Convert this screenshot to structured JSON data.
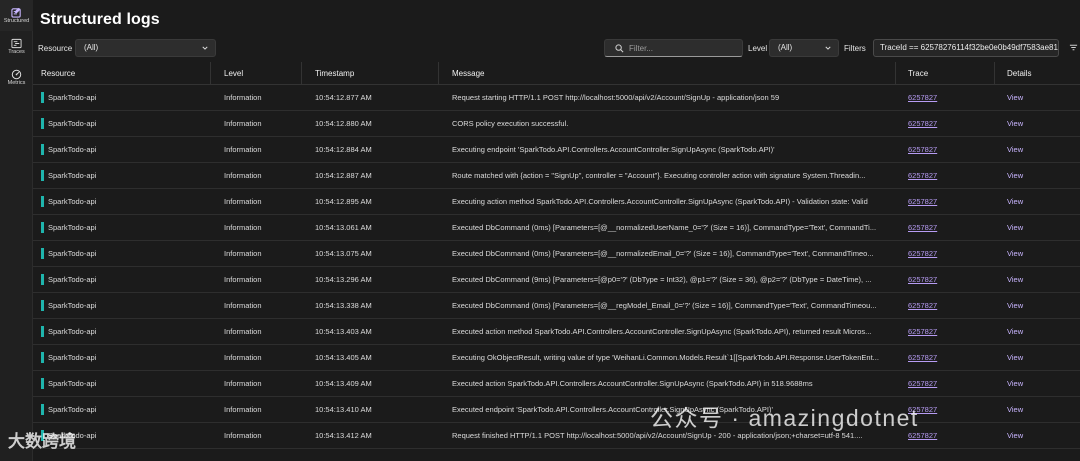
{
  "rail": {
    "items": [
      {
        "label": "Structured",
        "active": true
      },
      {
        "label": "Traces",
        "active": false
      },
      {
        "label": "Metrics",
        "active": false
      }
    ]
  },
  "header": {
    "title": "Structured logs"
  },
  "toolbar": {
    "resource_label": "Resource",
    "resource_value": "(All)",
    "search_placeholder": "Filter...",
    "level_label": "Level",
    "level_value": "(All)",
    "filters_label": "Filters",
    "filter_chip": "TraceId == 62578276114f32be0e0b49df7583ae81"
  },
  "table": {
    "columns": [
      "Resource",
      "Level",
      "Timestamp",
      "Message",
      "Trace",
      "Details"
    ],
    "rows": [
      {
        "resource": "SparkTodo-api",
        "level": "Information",
        "timestamp": "10:54:12.877 AM",
        "message": "Request starting HTTP/1.1 POST http://localhost:5000/api/v2/Account/SignUp - application/json 59",
        "trace": "6257827",
        "details": "View"
      },
      {
        "resource": "SparkTodo-api",
        "level": "Information",
        "timestamp": "10:54:12.880 AM",
        "message": "CORS policy execution successful.",
        "trace": "6257827",
        "details": "View"
      },
      {
        "resource": "SparkTodo-api",
        "level": "Information",
        "timestamp": "10:54:12.884 AM",
        "message": "Executing endpoint 'SparkTodo.API.Controllers.AccountController.SignUpAsync (SparkTodo.API)'",
        "trace": "6257827",
        "details": "View"
      },
      {
        "resource": "SparkTodo-api",
        "level": "Information",
        "timestamp": "10:54:12.887 AM",
        "message": "Route matched with {action = \"SignUp\", controller = \"Account\"}. Executing controller action with signature System.Threadin...",
        "trace": "6257827",
        "details": "View"
      },
      {
        "resource": "SparkTodo-api",
        "level": "Information",
        "timestamp": "10:54:12.895 AM",
        "message": "Executing action method SparkTodo.API.Controllers.AccountController.SignUpAsync (SparkTodo.API) - Validation state: Valid",
        "trace": "6257827",
        "details": "View"
      },
      {
        "resource": "SparkTodo-api",
        "level": "Information",
        "timestamp": "10:54:13.061 AM",
        "message": "Executed DbCommand (0ms) [Parameters=[@__normalizedUserName_0='?' (Size = 16)], CommandType='Text', CommandTi...",
        "trace": "6257827",
        "details": "View"
      },
      {
        "resource": "SparkTodo-api",
        "level": "Information",
        "timestamp": "10:54:13.075 AM",
        "message": "Executed DbCommand (0ms) [Parameters=[@__normalizedEmail_0='?' (Size = 16)], CommandType='Text', CommandTimeo...",
        "trace": "6257827",
        "details": "View"
      },
      {
        "resource": "SparkTodo-api",
        "level": "Information",
        "timestamp": "10:54:13.296 AM",
        "message": "Executed DbCommand (9ms) [Parameters=[@p0='?' (DbType = Int32), @p1='?' (Size = 36), @p2='?' (DbType = DateTime), ...",
        "trace": "6257827",
        "details": "View"
      },
      {
        "resource": "SparkTodo-api",
        "level": "Information",
        "timestamp": "10:54:13.338 AM",
        "message": "Executed DbCommand (0ms) [Parameters=[@__regModel_Email_0='?' (Size = 16)], CommandType='Text', CommandTimeou...",
        "trace": "6257827",
        "details": "View"
      },
      {
        "resource": "SparkTodo-api",
        "level": "Information",
        "timestamp": "10:54:13.403 AM",
        "message": "Executed action method SparkTodo.API.Controllers.AccountController.SignUpAsync (SparkTodo.API), returned result Micros...",
        "trace": "6257827",
        "details": "View"
      },
      {
        "resource": "SparkTodo-api",
        "level": "Information",
        "timestamp": "10:54:13.405 AM",
        "message": "Executing OkObjectResult, writing value of type 'WeihanLi.Common.Models.Result`1[[SparkTodo.API.Response.UserTokenEnt...",
        "trace": "6257827",
        "details": "View"
      },
      {
        "resource": "SparkTodo-api",
        "level": "Information",
        "timestamp": "10:54:13.409 AM",
        "message": "Executed action SparkTodo.API.Controllers.AccountController.SignUpAsync (SparkTodo.API) in 518.9688ms",
        "trace": "6257827",
        "details": "View"
      },
      {
        "resource": "SparkTodo-api",
        "level": "Information",
        "timestamp": "10:54:13.410 AM",
        "message": "Executed endpoint 'SparkTodo.API.Controllers.AccountController.SignUpAsync (SparkTodo.API)'",
        "trace": "6257827",
        "details": "View"
      },
      {
        "resource": "SparkTodo-api",
        "level": "Information",
        "timestamp": "10:54:13.412 AM",
        "message": "Request finished HTTP/1.1 POST http://localhost:5000/api/v2/Account/SignUp - 200 - application/json;+charset=utf-8 541....",
        "trace": "6257827",
        "details": "View"
      }
    ]
  },
  "watermark": {
    "right": "公众号 · amazingdotnet",
    "left": "大数跨境"
  },
  "colors": {
    "background": "#1b1b1b",
    "resource_accent": "#1fb5ad",
    "link": "#b79cf4"
  }
}
